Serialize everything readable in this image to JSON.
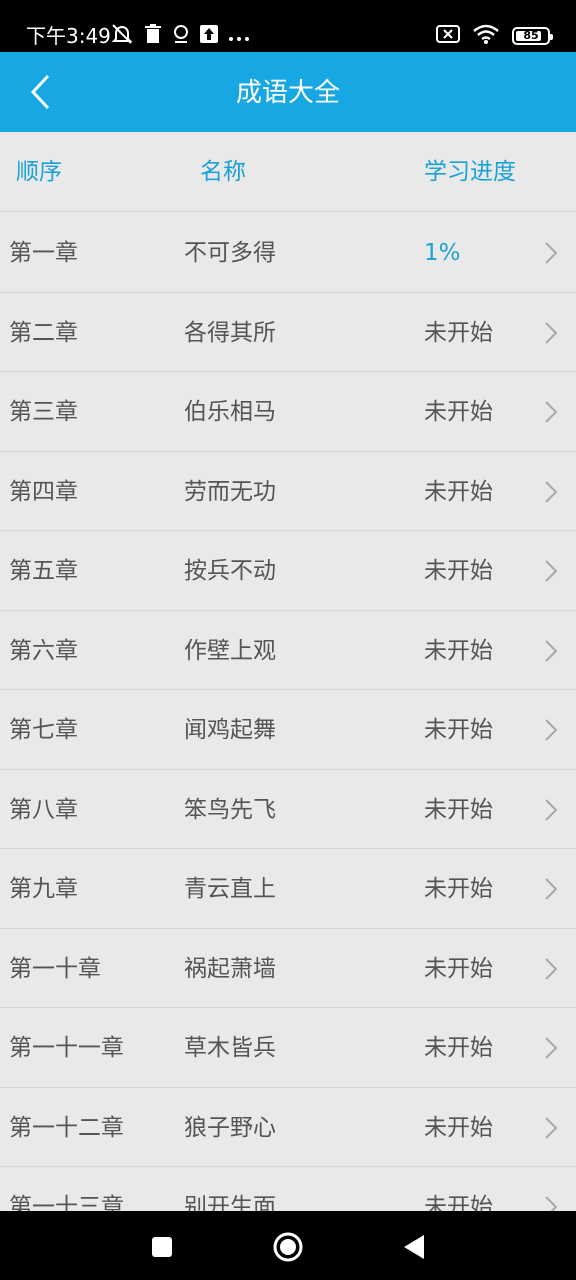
{
  "status_bar": {
    "time": "下午3:49",
    "left_icons": [
      "mute-bell-icon",
      "trash-icon",
      "location-icon",
      "upload-icon",
      "more-dots-icon"
    ],
    "right_icons": [
      "no-sim-icon",
      "wifi-icon",
      "battery-icon"
    ],
    "battery_level": "85"
  },
  "app_bar": {
    "title": "成语大全",
    "back_icon": "chevron-left-icon"
  },
  "table": {
    "headers": {
      "order": "顺序",
      "name": "名称",
      "progress": "学习进度"
    },
    "rows": [
      {
        "order": "第一章",
        "name": "不可多得",
        "progress": "1%",
        "started": true
      },
      {
        "order": "第二章",
        "name": "各得其所",
        "progress": "未开始",
        "started": false
      },
      {
        "order": "第三章",
        "name": "伯乐相马",
        "progress": "未开始",
        "started": false
      },
      {
        "order": "第四章",
        "name": "劳而无功",
        "progress": "未开始",
        "started": false
      },
      {
        "order": "第五章",
        "name": "按兵不动",
        "progress": "未开始",
        "started": false
      },
      {
        "order": "第六章",
        "name": "作壁上观",
        "progress": "未开始",
        "started": false
      },
      {
        "order": "第七章",
        "name": "闻鸡起舞",
        "progress": "未开始",
        "started": false
      },
      {
        "order": "第八章",
        "name": "笨鸟先飞",
        "progress": "未开始",
        "started": false
      },
      {
        "order": "第九章",
        "name": "青云直上",
        "progress": "未开始",
        "started": false
      },
      {
        "order": "第一十章",
        "name": "祸起萧墙",
        "progress": "未开始",
        "started": false
      },
      {
        "order": "第一十一章",
        "name": "草木皆兵",
        "progress": "未开始",
        "started": false
      },
      {
        "order": "第一十二章",
        "name": "狼子野心",
        "progress": "未开始",
        "started": false
      },
      {
        "order": "第一十三章",
        "name": "别开生面",
        "progress": "未开始",
        "started": false
      }
    ]
  },
  "nav_bar": {
    "buttons": [
      "recent-apps-icon",
      "home-icon",
      "back-triangle-icon"
    ]
  },
  "colors": {
    "accent": "#17a7e2",
    "header_text": "#1aa2d6",
    "background": "#e9e9e9",
    "row_text": "#555555"
  }
}
